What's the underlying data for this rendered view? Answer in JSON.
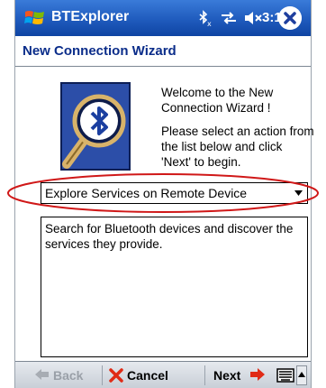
{
  "titlebar": {
    "app_title": "BTExplorer",
    "time": "3:18",
    "icons": [
      "windows-start-icon",
      "bluetooth-status-icon",
      "sync-icon",
      "volume-icon",
      "close-icon"
    ]
  },
  "page": {
    "title": "New Connection Wizard",
    "welcome_text": "Welcome to the New Connection Wizard !",
    "instruction_text": "Please select an action from the list below and click 'Next' to begin."
  },
  "action_select": {
    "selected": "Explore Services on Remote Device"
  },
  "description": {
    "text": "Search for Bluetooth devices and discover the services they provide."
  },
  "commands": {
    "back_label": "Back",
    "cancel_label": "Cancel",
    "next_label": "Next"
  },
  "colors": {
    "titlebar": "#1f5bbd",
    "heading": "#0b2d8a",
    "highlight_oval": "#d01818",
    "bluetooth_blue": "#1b3fa0"
  }
}
